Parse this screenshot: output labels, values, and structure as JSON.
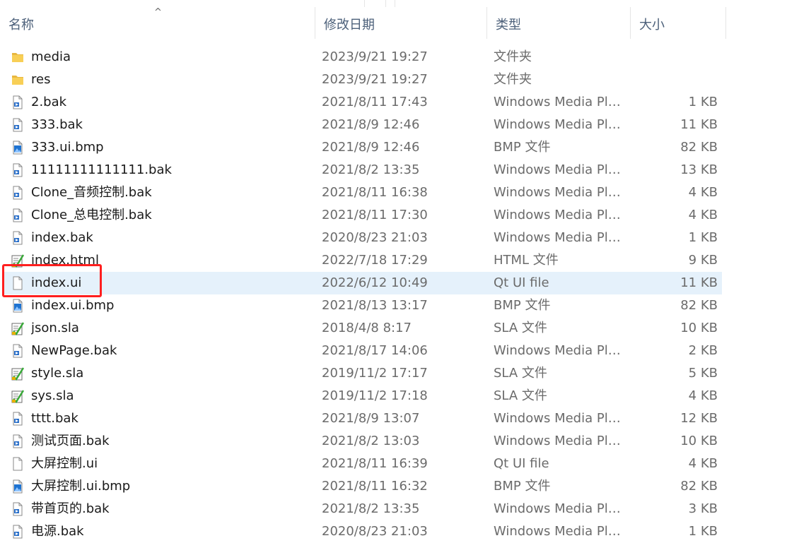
{
  "columns": {
    "name": "名称",
    "date": "修改日期",
    "type": "类型",
    "size": "大小"
  },
  "colors": {
    "selection": "#e5f1fb",
    "highlight_box": "#ff1f1f",
    "folder": "#f8cf56"
  },
  "files": [
    {
      "name": "media",
      "date": "2023/9/21 19:27",
      "type": "文件夹",
      "size": "",
      "icon": "folder-icon"
    },
    {
      "name": "res",
      "date": "2023/9/21 19:27",
      "type": "文件夹",
      "size": "",
      "icon": "folder-icon"
    },
    {
      "name": "2.bak",
      "date": "2021/8/11 17:43",
      "type": "Windows Media Pla...",
      "size": "1 KB",
      "icon": "media-file-icon"
    },
    {
      "name": "333.bak",
      "date": "2021/8/9 12:46",
      "type": "Windows Media Pla...",
      "size": "11 KB",
      "icon": "media-file-icon"
    },
    {
      "name": "333.ui.bmp",
      "date": "2021/8/9 12:46",
      "type": "BMP 文件",
      "size": "82 KB",
      "icon": "image-file-icon"
    },
    {
      "name": "11111111111111.bak",
      "date": "2021/8/2 13:35",
      "type": "Windows Media Pla...",
      "size": "13 KB",
      "icon": "media-file-icon"
    },
    {
      "name": "Clone_音频控制.bak",
      "date": "2021/8/11 16:38",
      "type": "Windows Media Pla...",
      "size": "4 KB",
      "icon": "media-file-icon"
    },
    {
      "name": "Clone_总电控制.bak",
      "date": "2021/8/11 17:30",
      "type": "Windows Media Pla...",
      "size": "4 KB",
      "icon": "media-file-icon"
    },
    {
      "name": "index.bak",
      "date": "2020/8/23 21:03",
      "type": "Windows Media Pla...",
      "size": "1 KB",
      "icon": "media-file-icon"
    },
    {
      "name": "index.html",
      "date": "2022/7/18 17:29",
      "type": "HTML 文件",
      "size": "9 KB",
      "icon": "checklist-file-icon"
    },
    {
      "name": "index.ui",
      "date": "2022/6/12 10:49",
      "type": "Qt UI file",
      "size": "11 KB",
      "icon": "blank-file-icon",
      "selected": true
    },
    {
      "name": "index.ui.bmp",
      "date": "2021/8/13 13:17",
      "type": "BMP 文件",
      "size": "82 KB",
      "icon": "image-file-icon"
    },
    {
      "name": "json.sla",
      "date": "2018/4/8 8:17",
      "type": "SLA 文件",
      "size": "10 KB",
      "icon": "checklist-file-icon"
    },
    {
      "name": "NewPage.bak",
      "date": "2021/8/17 14:06",
      "type": "Windows Media Pla...",
      "size": "2 KB",
      "icon": "media-file-icon"
    },
    {
      "name": "style.sla",
      "date": "2019/11/2 17:17",
      "type": "SLA 文件",
      "size": "5 KB",
      "icon": "checklist-file-icon"
    },
    {
      "name": "sys.sla",
      "date": "2019/11/2 17:18",
      "type": "SLA 文件",
      "size": "4 KB",
      "icon": "checklist-file-icon"
    },
    {
      "name": "tttt.bak",
      "date": "2021/8/9 13:07",
      "type": "Windows Media Pla...",
      "size": "12 KB",
      "icon": "media-file-icon"
    },
    {
      "name": "测试页面.bak",
      "date": "2021/8/2 13:03",
      "type": "Windows Media Pla...",
      "size": "10 KB",
      "icon": "media-file-icon"
    },
    {
      "name": "大屏控制.ui",
      "date": "2021/8/11 16:39",
      "type": "Qt UI file",
      "size": "4 KB",
      "icon": "blank-file-icon"
    },
    {
      "name": "大屏控制.ui.bmp",
      "date": "2021/8/11 16:32",
      "type": "BMP 文件",
      "size": "82 KB",
      "icon": "image-file-icon"
    },
    {
      "name": "带首页的.bak",
      "date": "2021/8/2 13:35",
      "type": "Windows Media Pla...",
      "size": "3 KB",
      "icon": "media-file-icon"
    },
    {
      "name": "电源.bak",
      "date": "2020/8/23 21:03",
      "type": "Windows Media Pla...",
      "size": "1 KB",
      "icon": "media-file-icon"
    }
  ]
}
